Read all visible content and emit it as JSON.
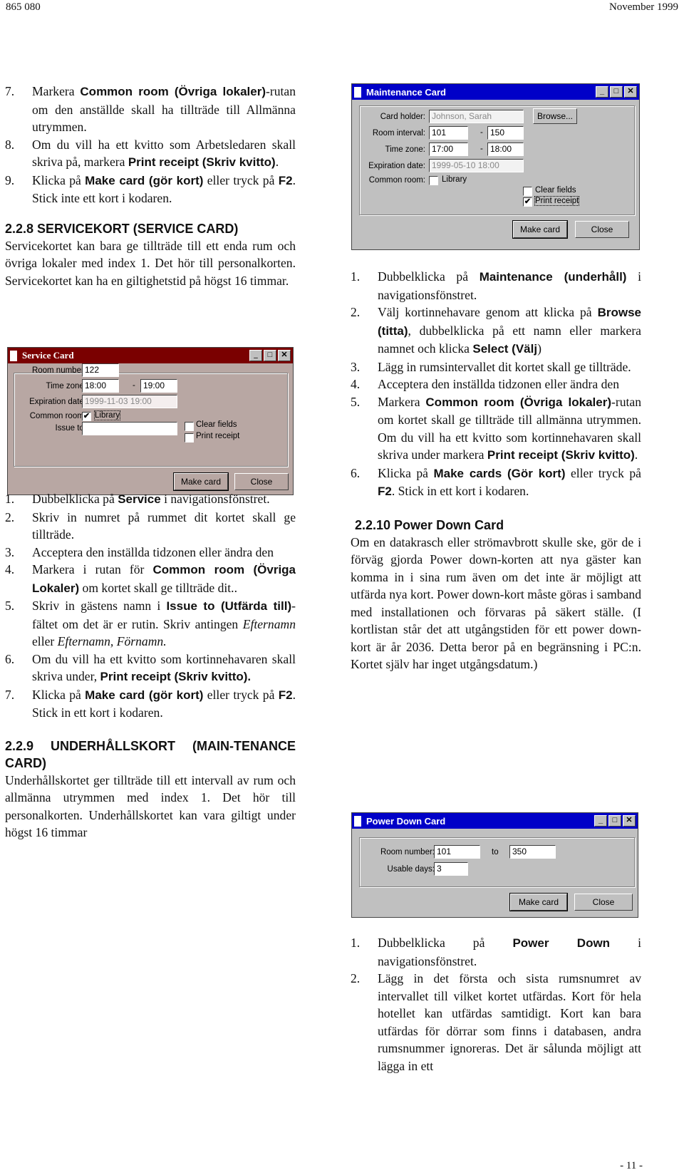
{
  "header": {
    "doc_number": "865 080",
    "date": "November 1999"
  },
  "footer": {
    "page": "- 11 -"
  },
  "left_column": {
    "steps_top": [
      {
        "num": "7.",
        "parts": [
          [
            "t",
            "Markera "
          ],
          [
            "b",
            "Common room (Övriga lokaler)"
          ],
          [
            "t",
            "-rutan om den anställde skall ha tillträde till Allmänna utrymmen."
          ]
        ]
      },
      {
        "num": "8.",
        "parts": [
          [
            "t",
            "Om du vill ha ett kvitto som Arbetsledaren skall skriva på, markera "
          ],
          [
            "b",
            "Print receipt (Skriv kvitto)"
          ],
          [
            "t",
            "."
          ]
        ]
      },
      {
        "num": "9.",
        "parts": [
          [
            "t",
            "Klicka på "
          ],
          [
            "b",
            "Make card (gör kort)"
          ],
          [
            "t",
            " eller tryck på "
          ],
          [
            "b",
            "F2"
          ],
          [
            "t",
            ". Stick inte ett kort i kodaren."
          ]
        ]
      }
    ],
    "section_service": {
      "heading": "2.2.8 SERVICEKORT (SERVICE CARD)",
      "body": "Servicekortet kan bara ge tillträde till ett enda rum och övriga lokaler med index 1. Det hör till personalkorten. Servicekortet kan ha en giltighetstid på högst 16 timmar."
    },
    "steps_service": [
      {
        "num": "1.",
        "parts": [
          [
            "t",
            "Dubbelklicka på "
          ],
          [
            "b",
            "Service"
          ],
          [
            "t",
            " i navigationsfönstret."
          ]
        ]
      },
      {
        "num": "2.",
        "parts": [
          [
            "t",
            "Skriv in numret på rummet dit kortet skall ge tillträde."
          ]
        ]
      },
      {
        "num": "3.",
        "parts": [
          [
            "t",
            "Acceptera den inställda tidzonen eller ändra den"
          ]
        ]
      },
      {
        "num": "4.",
        "parts": [
          [
            "t",
            "Markera i rutan för "
          ],
          [
            "b",
            "Common room (Övriga Lokaler)"
          ],
          [
            "t",
            " om kortet skall ge tillträde dit.."
          ]
        ]
      },
      {
        "num": "5.",
        "parts": [
          [
            "t",
            "Skriv in gästens namn i "
          ],
          [
            "b",
            "Issue to (Utfärda till)"
          ],
          [
            "t",
            "-fältet om det är er rutin. Skriv antingen "
          ],
          [
            "i",
            "Efternamn"
          ],
          [
            "t",
            " eller "
          ],
          [
            "i",
            "Efternamn, Förnamn."
          ]
        ]
      },
      {
        "num": "6.",
        "parts": [
          [
            "t",
            "Om du vill ha ett kvitto som kortinnehavaren skall skriva under, "
          ],
          [
            "b",
            "Print receipt (Skriv kvitto)."
          ]
        ]
      },
      {
        "num": "7.",
        "parts": [
          [
            "t",
            "Klicka på "
          ],
          [
            "b",
            "Make card (gör kort)"
          ],
          [
            "t",
            " eller tryck på "
          ],
          [
            "b",
            "F2"
          ],
          [
            "t",
            ". Stick in ett kort i kodaren."
          ]
        ]
      }
    ],
    "section_maint": {
      "heading": "2.2.9 UNDERHÅLLSKORT (MAIN-TENANCE CARD)",
      "body": "Underhållskortet ger tillträde till ett intervall av rum och allmänna utrymmen med index 1. Det hör till personalkorten. Underhållskortet kan vara giltigt under högst 16 timmar"
    }
  },
  "right_column": {
    "steps_maint": [
      {
        "num": "1.",
        "parts": [
          [
            "t",
            "Dubbelklicka på "
          ],
          [
            "b",
            "Maintenance (underhåll)"
          ],
          [
            "t",
            " i navigationsfönstret."
          ]
        ]
      },
      {
        "num": "2.",
        "parts": [
          [
            "t",
            "Välj kortinnehavare genom att klicka på "
          ],
          [
            "b",
            "Browse (titta)"
          ],
          [
            "t",
            ", dubbelklicka på ett namn eller markera namnet och klicka "
          ],
          [
            "b",
            "Select (Välj"
          ],
          [
            "t",
            ")"
          ]
        ]
      },
      {
        "num": "3.",
        "parts": [
          [
            "t",
            "Lägg in rumsintervallet dit kortet skall ge tillträde."
          ]
        ]
      },
      {
        "num": "4.",
        "parts": [
          [
            "t",
            "Acceptera den inställda tidzonen eller ändra den"
          ]
        ]
      },
      {
        "num": "5.",
        "parts": [
          [
            "t",
            "Markera "
          ],
          [
            "b",
            "Common room (Övriga lokaler)"
          ],
          [
            "t",
            "-rutan om kortet skall ge tillträde till allmänna utrymmen. Om du vill ha ett kvitto som kortinnehavaren skall skriva under markera "
          ],
          [
            "b",
            "Print receipt (Skriv kvitto)"
          ],
          [
            "t",
            "."
          ]
        ]
      },
      {
        "num": "6.",
        "parts": [
          [
            "t",
            "Klicka på "
          ],
          [
            "b",
            "Make cards (Gör kort)"
          ],
          [
            "t",
            " eller tryck på "
          ],
          [
            "b",
            "F2"
          ],
          [
            "t",
            ". Stick in ett kort i kodaren."
          ]
        ]
      }
    ],
    "section_power": {
      "heading": "2.2.10 Power Down Card",
      "body": "Om en datakrasch eller strömavbrott skulle ske, gör de i förväg gjorda Power down-korten att nya gäster kan komma in i sina rum även om det inte är möjligt att utfärda nya kort. Power down-kort måste göras i samband med installationen och förvaras på säkert ställe. (I kortlistan står det att utgångstiden för ett power down-kort är år 2036. Detta beror på en begränsning i PC:n. Kortet själv har inget utgångsdatum.)"
    },
    "steps_power": [
      {
        "num": "1.",
        "parts": [
          [
            "t",
            "Dubbelklicka på "
          ],
          [
            "b",
            "Power Down"
          ],
          [
            "t",
            " i navigationsfönstret."
          ]
        ]
      },
      {
        "num": "2.",
        "parts": [
          [
            "t",
            "Lägg in det första och sista rumsnumret av intervallet till vilket kortet utfärdas. Kort för hela hotellet kan utfärdas samtidigt. Kort kan bara utfärdas för dörrar som finns i databasen, andra rumsnummer ignoreras. Det är sålunda möjligt att lägga in ett"
          ]
        ]
      }
    ]
  },
  "dialogs": {
    "service": {
      "title": "Service Card",
      "title_bar_color": "#7a0000",
      "room_number_label": "Room number:",
      "room_number": "122",
      "time_zone_label": "Time zone:",
      "time_from": "18:00",
      "time_to": "19:00",
      "dash": "-",
      "expiration_label": "Expiration date:",
      "expiration": "1999-11-03 19:00",
      "common_room_label": "Common room:",
      "library_label": "Library",
      "library_checked": true,
      "issue_to_label": "Issue to:",
      "issue_to": "",
      "clear_fields_label": "Clear fields",
      "clear_fields_checked": false,
      "print_receipt_label": "Print receipt",
      "print_receipt_checked": false,
      "make_card": "Make card",
      "close": "Close"
    },
    "maintenance": {
      "title": "Maintenance Card",
      "title_bar_color": "#0000c8",
      "card_holder_label": "Card holder:",
      "card_holder": "Johnson, Sarah",
      "browse": "Browse...",
      "room_interval_label": "Room interval:",
      "room_from": "101",
      "room_to": "150",
      "dash": "-",
      "time_zone_label": "Time zone:",
      "time_from": "17:00",
      "time_to": "18:00",
      "expiration_label": "Expiration date:",
      "expiration": "1999-05-10 18:00",
      "common_room_label": "Common room:",
      "library_label": "Library",
      "library_checked": false,
      "clear_fields_label": "Clear fields",
      "clear_fields_checked": false,
      "print_receipt_label": "Print receipt",
      "print_receipt_checked": true,
      "make_card": "Make card",
      "close": "Close"
    },
    "power_down": {
      "title": "Power Down Card",
      "title_bar_color": "#0000c8",
      "room_number_label": "Room number:",
      "room_from": "101",
      "to_label": "to",
      "room_to": "350",
      "usable_days_label": "Usable days:",
      "usable_days": "3",
      "make_card": "Make card",
      "close": "Close"
    },
    "window_buttons": {
      "minimize": "_",
      "maximize": "□",
      "close": "✕"
    }
  }
}
